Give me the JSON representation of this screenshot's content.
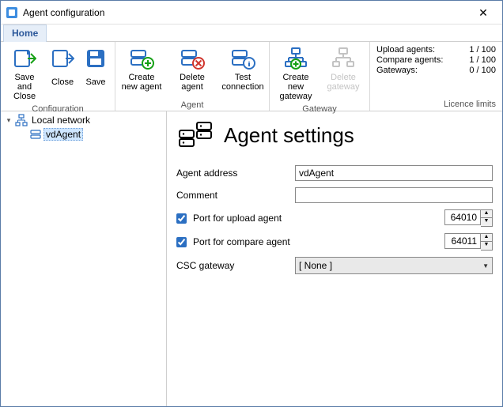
{
  "window": {
    "title": "Agent configuration"
  },
  "tabs": {
    "home": "Home"
  },
  "ribbon": {
    "config": {
      "label": "Configuration",
      "save_and_close": "Save\nand Close",
      "close": "Close",
      "save": "Save"
    },
    "agent": {
      "label": "Agent",
      "create_new_agent": "Create\nnew agent",
      "delete_agent": "Delete agent",
      "test_connection": "Test\nconnection"
    },
    "gateway": {
      "label": "Gateway",
      "create_new_gateway": "Create new\ngateway",
      "delete_gateway": "Delete\ngateway"
    },
    "licence": {
      "caption": "Licence limits",
      "upload_label": "Upload agents:",
      "upload_value": "1 / 100",
      "compare_label": "Compare agents:",
      "compare_value": "1 / 100",
      "gateways_label": "Gateways:",
      "gateways_value": "0 / 100"
    }
  },
  "tree": {
    "root": "Local network",
    "child": "vdAgent"
  },
  "settings": {
    "heading": "Agent settings",
    "address_label": "Agent address",
    "address_value": "vdAgent",
    "comment_label": "Comment",
    "comment_value": "",
    "port_upload_label": "Port for upload agent",
    "port_upload_value": "64010",
    "port_compare_label": "Port for compare agent",
    "port_compare_value": "64011",
    "csc_label": "CSC gateway",
    "csc_value": "[ None ]"
  }
}
